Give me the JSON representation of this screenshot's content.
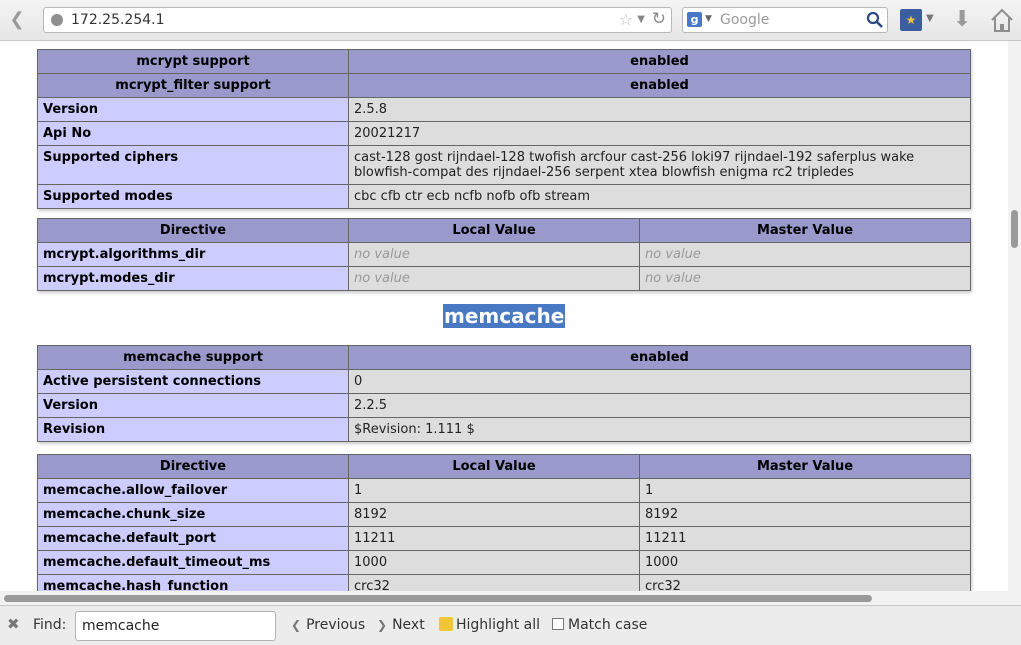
{
  "browser": {
    "url": "172.25.254.1",
    "search_placeholder": "Google"
  },
  "mcrypt": {
    "info_rows": [
      {
        "name": "mcrypt support",
        "value": "enabled",
        "header": true
      },
      {
        "name": "mcrypt_filter support",
        "value": "enabled",
        "header": true
      },
      {
        "name": "Version",
        "value": "2.5.8"
      },
      {
        "name": "Api No",
        "value": "20021217"
      },
      {
        "name": "Supported ciphers",
        "value": "cast-128 gost rijndael-128 twofish arcfour cast-256 loki97 rijndael-192 saferplus wake blowfish-compat des rijndael-256 serpent xtea blowfish enigma rc2 tripledes"
      },
      {
        "name": "Supported modes",
        "value": "cbc cfb ctr ecb ncfb nofb ofb stream"
      }
    ],
    "directive_headers": [
      "Directive",
      "Local Value",
      "Master Value"
    ],
    "directives": [
      {
        "name": "mcrypt.algorithms_dir",
        "local": "no value",
        "master": "no value"
      },
      {
        "name": "mcrypt.modes_dir",
        "local": "no value",
        "master": "no value"
      }
    ]
  },
  "memcache": {
    "title": "memcache",
    "support_header": {
      "name": "memcache support",
      "value": "enabled"
    },
    "info_rows": [
      {
        "name": "Active persistent connections",
        "value": "0"
      },
      {
        "name": "Version",
        "value": "2.2.5"
      },
      {
        "name": "Revision",
        "value": "$Revision: 1.111 $"
      }
    ],
    "directive_headers": [
      "Directive",
      "Local Value",
      "Master Value"
    ],
    "directives": [
      {
        "name": "memcache.allow_failover",
        "local": "1",
        "master": "1"
      },
      {
        "name": "memcache.chunk_size",
        "local": "8192",
        "master": "8192"
      },
      {
        "name": "memcache.default_port",
        "local": "11211",
        "master": "11211"
      },
      {
        "name": "memcache.default_timeout_ms",
        "local": "1000",
        "master": "1000"
      },
      {
        "name": "memcache.hash_function",
        "local": "crc32",
        "master": "crc32"
      }
    ]
  },
  "findbar": {
    "label": "Find:",
    "query": "memcache",
    "previous_label": "Previous",
    "next_label": "Next",
    "highlight_label": "Highlight all",
    "match_case_label": "Match case"
  },
  "colors": {
    "header_bg": "#9999cc",
    "label_bg": "#ccccff",
    "value_bg": "#dddddd",
    "selection": "#4a79c4"
  }
}
